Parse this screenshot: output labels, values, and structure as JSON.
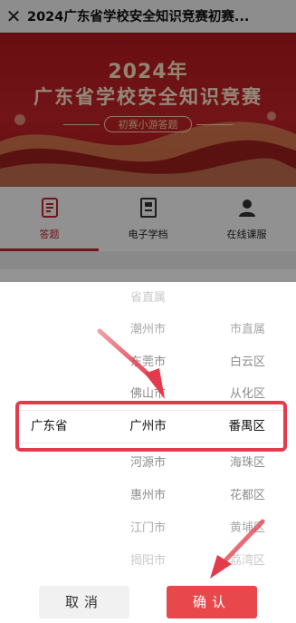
{
  "navbar": {
    "title": "2024广东省学校安全知识竞赛初赛...",
    "close_icon": "close-icon"
  },
  "banner": {
    "year": "2024年",
    "title": "广东省学校安全知识竞赛",
    "subtitle": "初赛小游答题"
  },
  "tabs": [
    {
      "label": "答题",
      "icon": "answer-sheet-icon",
      "active": true
    },
    {
      "label": "电子学档",
      "icon": "document-icon",
      "active": false
    },
    {
      "label": "在线课服",
      "icon": "person-service-icon",
      "active": false
    }
  ],
  "picker": {
    "provinces": {
      "above": [
        "",
        "",
        "",
        ""
      ],
      "selected": "广东省",
      "below": [
        "",
        "",
        "",
        ""
      ]
    },
    "cities": {
      "above": [
        "省直属",
        "潮州市",
        "东莞市",
        "佛山市"
      ],
      "selected": "广州市",
      "below": [
        "河源市",
        "惠州市",
        "江门市",
        "揭阳市"
      ]
    },
    "districts": {
      "above": [
        "",
        "市直属",
        "白云区",
        "从化区"
      ],
      "selected": "番禺区",
      "below": [
        "海珠区",
        "花都区",
        "黄埔区",
        "荔湾区"
      ]
    }
  },
  "buttons": {
    "cancel": "取消",
    "confirm": "确认"
  },
  "colors": {
    "brand_red": "#c4242a",
    "highlight_box": "#e33b4b",
    "confirm_button": "#e8484c"
  }
}
